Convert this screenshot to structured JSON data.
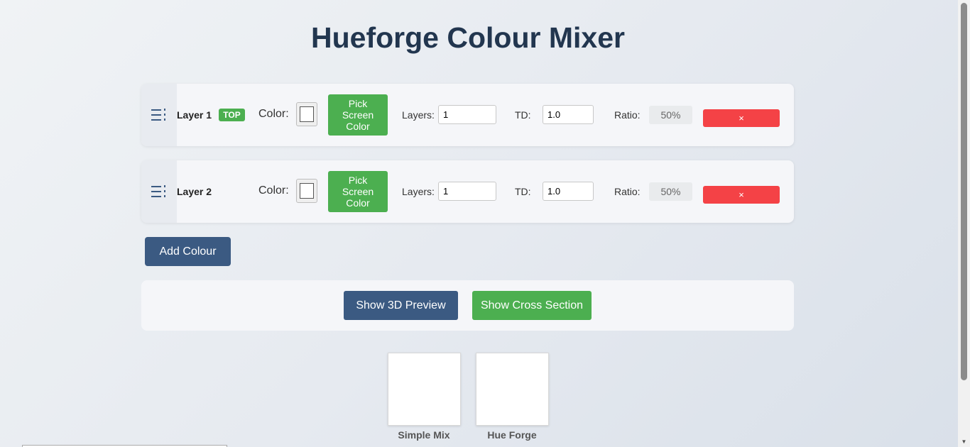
{
  "page": {
    "title": "Hueforge Colour Mixer"
  },
  "layers": [
    {
      "name": "Layer 1",
      "badge": "TOP",
      "color_label": "Color:",
      "color_value": "#ffffff",
      "pick_label": "Pick Screen Color",
      "layers_label": "Layers:",
      "layers_value": "1",
      "td_label": "TD:",
      "td_value": "1.0",
      "ratio_label": "Ratio:",
      "ratio_value": "50%",
      "delete_label": "×"
    },
    {
      "name": "Layer 2",
      "badge": "",
      "color_label": "Color:",
      "color_value": "#ffffff",
      "pick_label": "Pick Screen Color",
      "layers_label": "Layers:",
      "layers_value": "1",
      "td_label": "TD:",
      "td_value": "1.0",
      "ratio_label": "Ratio:",
      "ratio_value": "50%",
      "delete_label": "×"
    }
  ],
  "actions": {
    "add_colour_label": "Add Colour",
    "show_3d_label": "Show 3D Preview",
    "show_cross_label": "Show Cross Section"
  },
  "results": [
    {
      "label": "Simple Mix",
      "color": "#ffffff"
    },
    {
      "label": "Hue Forge",
      "color": "#ffffff"
    }
  ],
  "icons": {
    "drag_handle": "drag-handle-icon",
    "delete": "close-icon",
    "scroll_up": "chevron-up-icon",
    "scroll_down": "chevron-down-icon"
  },
  "colors": {
    "primary": "#3b5a82",
    "success": "#4caf50",
    "danger": "#f44246",
    "title": "#22364f"
  }
}
